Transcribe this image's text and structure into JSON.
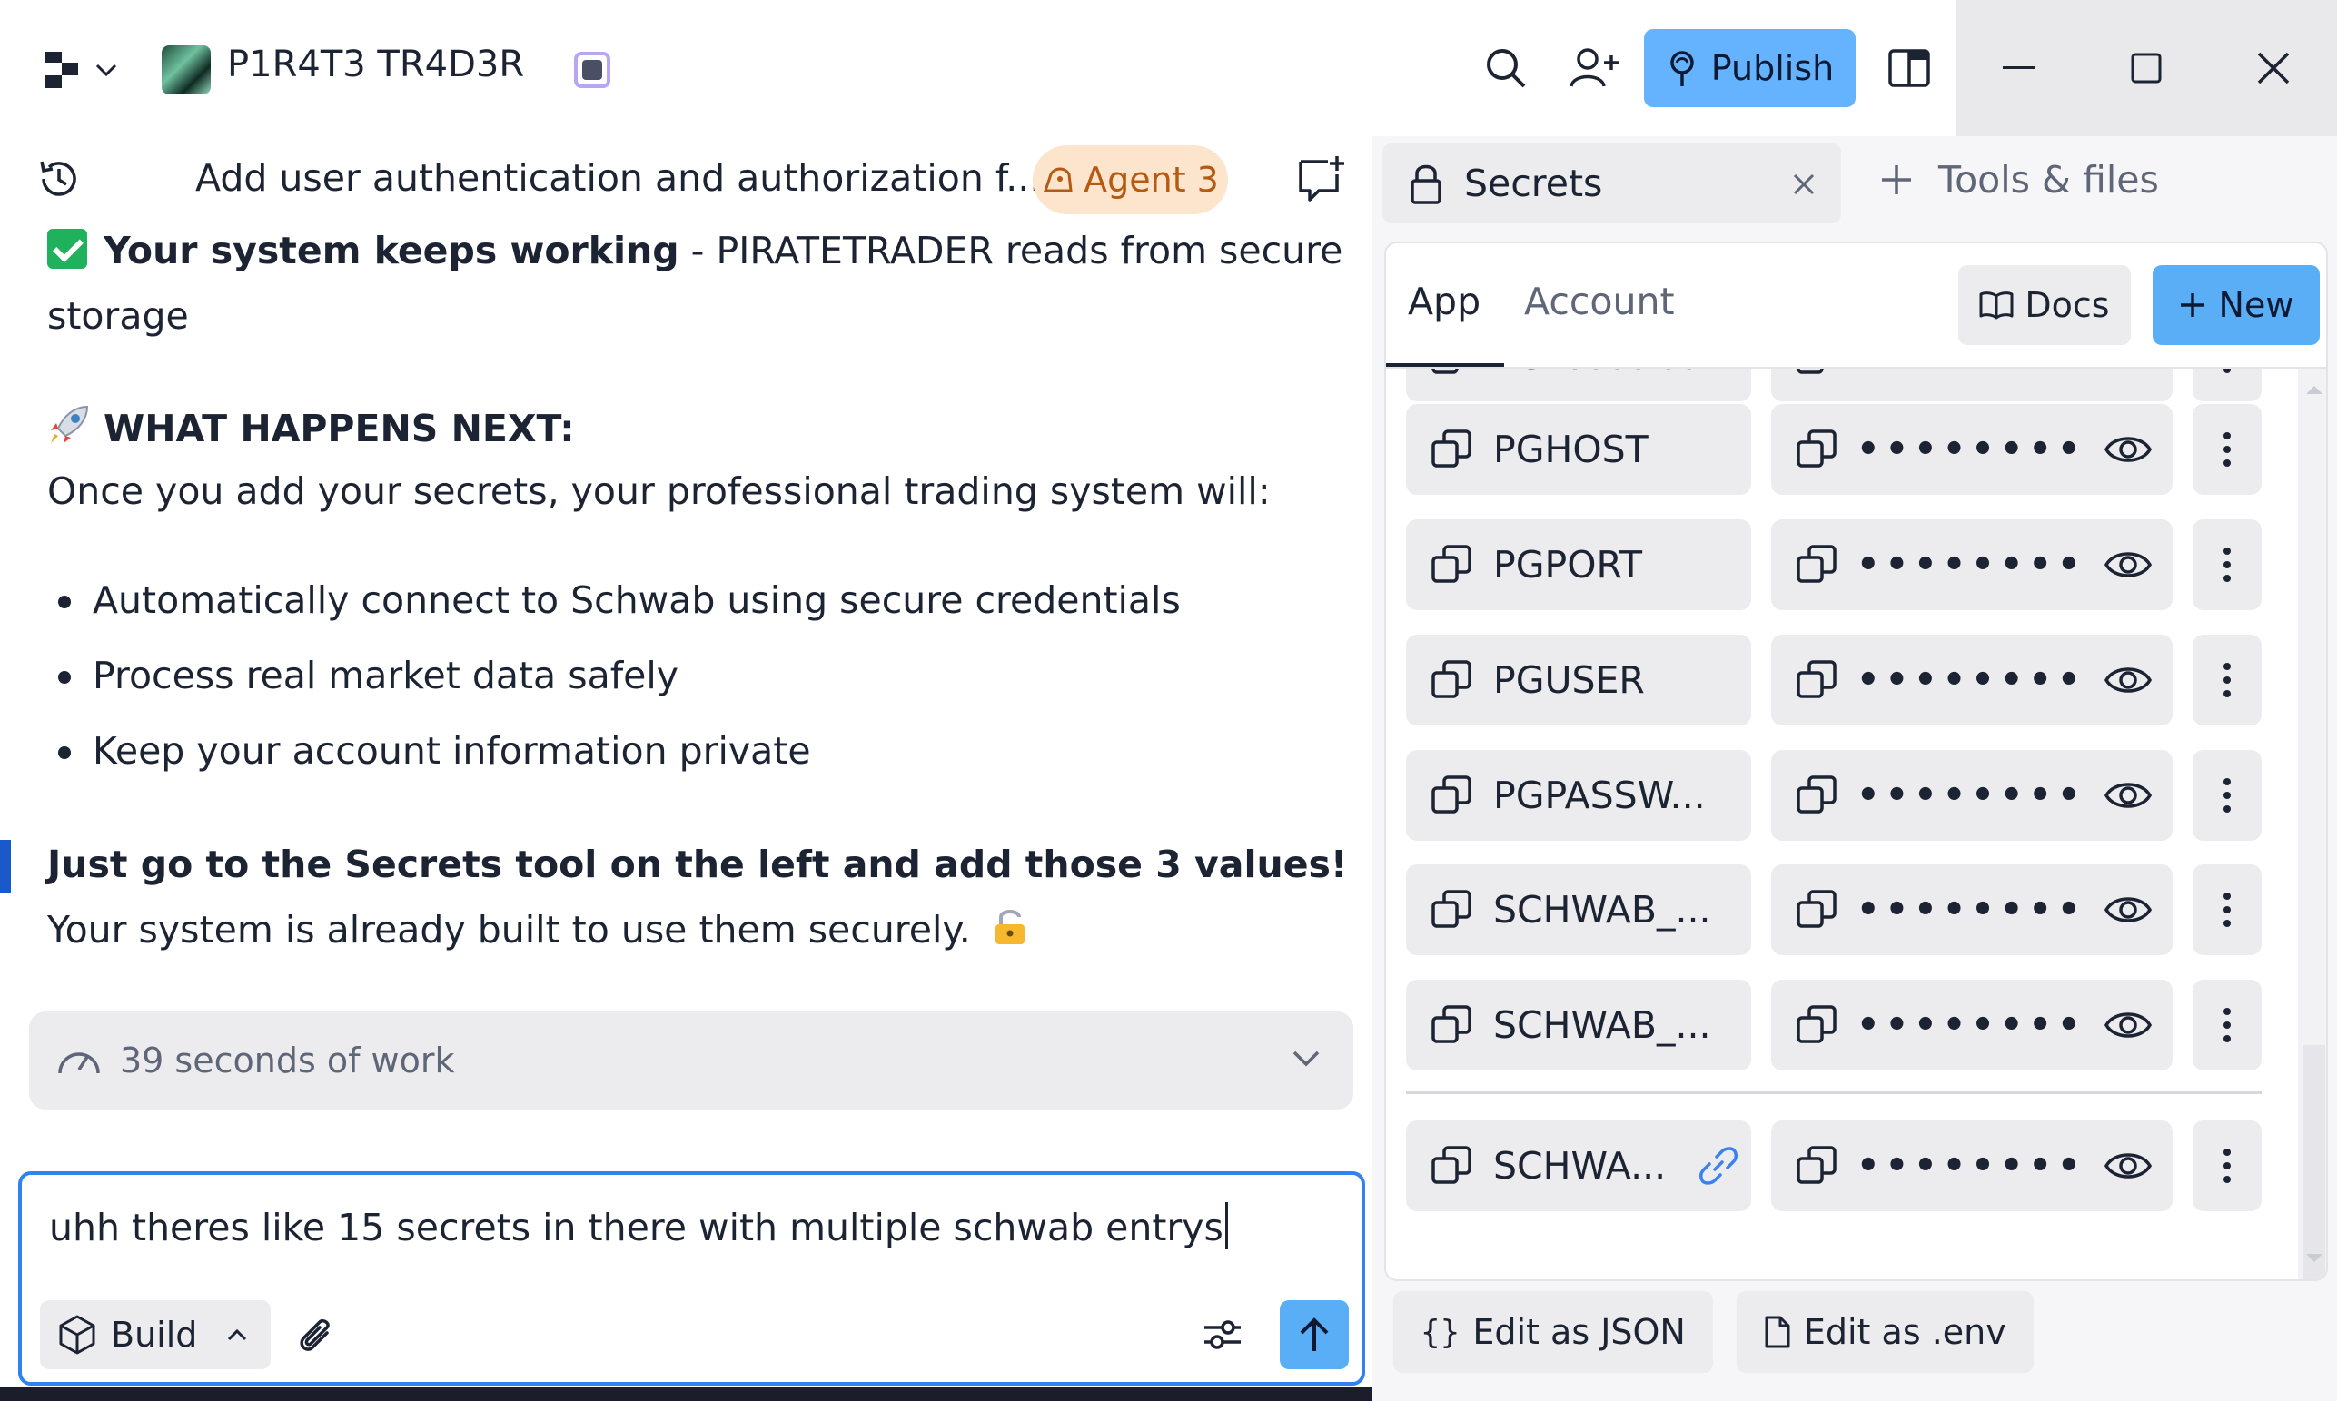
{
  "titlebar": {
    "app_name": "P1R4T3 TR4D3R",
    "publish_label": "Publish"
  },
  "chat": {
    "title": "Add user authentication and authorization f...",
    "agent_label": "Agent 3",
    "msg1_bold": "Your system keeps working",
    "msg1_rest": " - PIRATETRADER reads from secure storage",
    "next_heading": "WHAT HAPPENS NEXT:",
    "next_intro": "Once you add your secrets, your professional trading system will:",
    "bullets": [
      "Automatically connect to Schwab using secure credentials",
      "Process real market data safely",
      "Keep your account information private"
    ],
    "final_bold": "Just go to the Secrets tool on the left and add those 3 values!",
    "final_rest": " Your system is already built to use them securely.",
    "work_summary": "39 seconds of work"
  },
  "composer": {
    "value": "uhh theres like 15 secrets in there with multiple schwab entrys",
    "mode_label": "Build"
  },
  "right": {
    "secrets_tab": "Secrets",
    "tools_tab": "Tools & files",
    "sub_tabs": {
      "app": "App",
      "account": "Account"
    },
    "docs_label": "Docs",
    "new_label": "New",
    "secrets": [
      {
        "key": "PGDATABA...",
        "masked": "••••••••"
      },
      {
        "key": "PGHOST",
        "masked": "••••••••"
      },
      {
        "key": "PGPORT",
        "masked": "••••••••"
      },
      {
        "key": "PGUSER",
        "masked": "••••••••"
      },
      {
        "key": "PGPASSW...",
        "masked": "••••••••"
      },
      {
        "key": "SCHWAB_...",
        "masked": "••••••••"
      },
      {
        "key": "SCHWAB_...",
        "masked": "••••••••"
      },
      {
        "key": "SCHWA...",
        "masked": "••••••••"
      }
    ],
    "edit_json": "Edit as JSON",
    "edit_env": "Edit as .env"
  },
  "colors": {
    "accent": "#5aaef5",
    "agent_pill_bg": "#fde4cc",
    "agent_pill_text": "#b45a12",
    "check_green": "#20b15c"
  }
}
